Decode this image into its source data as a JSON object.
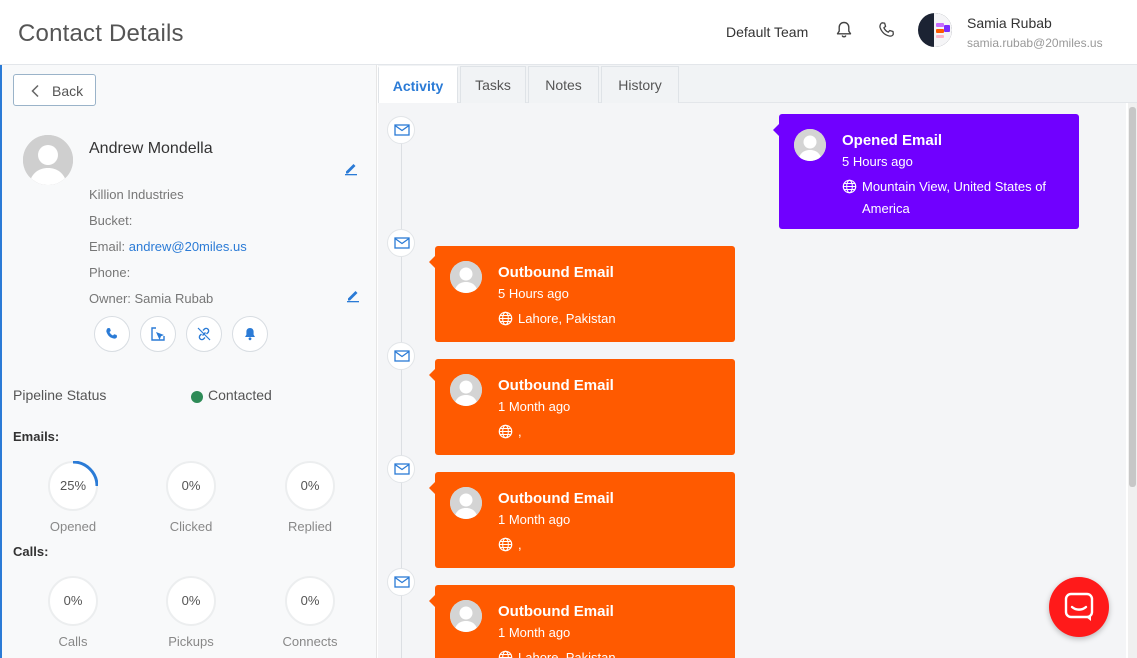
{
  "header": {
    "title": "Contact Details",
    "team": "Default Team",
    "user_name": "Samia Rubab",
    "user_email": "samia.rubab@20miles.us"
  },
  "left": {
    "back_label": "Back",
    "contact_name": "Andrew Mondella",
    "company": "Killion Industries",
    "bucket_label": "Bucket:",
    "email_label": "Email:",
    "email_value": "andrew@20miles.us",
    "phone_label": "Phone:",
    "owner_label": "Owner: Samia Rubab",
    "pipeline_label": "Pipeline Status",
    "pipeline_value": "Contacted",
    "pipeline_color": "#2e8b57",
    "emails_label": "Emails:",
    "calls_label": "Calls:",
    "email_stats": [
      {
        "value": "25%",
        "label": "Opened",
        "progress": 0.25
      },
      {
        "value": "0%",
        "label": "Clicked",
        "progress": 0
      },
      {
        "value": "0%",
        "label": "Replied",
        "progress": 0
      }
    ],
    "call_stats": [
      {
        "value": "0%",
        "label": "Calls",
        "progress": 0
      },
      {
        "value": "0%",
        "label": "Pickups",
        "progress": 0
      },
      {
        "value": "0%",
        "label": "Connects",
        "progress": 0
      }
    ]
  },
  "tabs": [
    "Activity",
    "Tasks",
    "Notes",
    "History"
  ],
  "activity": [
    {
      "title": "Opened Email",
      "time": "5 Hours ago",
      "location": "Mountain View, United States of America",
      "color": "#7000ff"
    },
    {
      "title": "Outbound Email",
      "time": "5 Hours ago",
      "location": "Lahore, Pakistan",
      "color": "#ff5a00"
    },
    {
      "title": "Outbound Email",
      "time": "1 Month ago",
      "location": ",",
      "color": "#ff5a00"
    },
    {
      "title": "Outbound Email",
      "time": "1 Month ago",
      "location": ",",
      "color": "#ff5a00"
    },
    {
      "title": "Outbound Email",
      "time": "1 Month ago",
      "location": "Lahore, Pakistan",
      "color": "#ff5a00"
    }
  ]
}
